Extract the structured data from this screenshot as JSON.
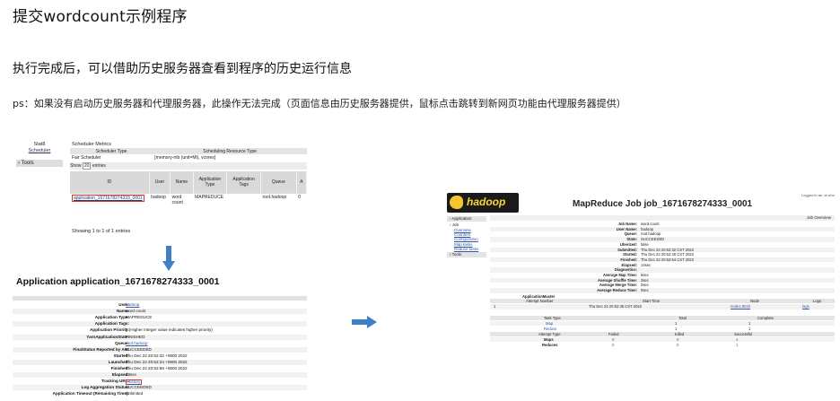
{
  "slide": {
    "title": "提交wordcount示例程序",
    "line1": "执行完成后，可以借助历史服务器查看到程序的历史运行信息",
    "note": "ps：如果没有启动历史服务器和代理服务器，此操作无法完成（页面信息由历史服务器提供，鼠标点击跳转到新网页功能由代理服务器提供）"
  },
  "scheduler_shot": {
    "nav": {
      "item1": "Stat8",
      "item2": "Scheduler",
      "tools": "› Tools"
    },
    "metrics_title": "Scheduler Metrics",
    "col_type": "Scheduler Type",
    "col_resource": "Scheduling Resource Type",
    "type_value": "Fair Scheduler",
    "resource_value": "[memory-mb (unit=Mi), vcores]",
    "show_label": "Show",
    "show_value": "20",
    "entries_label": "entries",
    "headers": [
      "ID",
      "User",
      "Name",
      "Application Type",
      "Application Tags",
      "Queue",
      "A"
    ],
    "row": {
      "id": "application_1671678274333_0001",
      "user": "hadoop",
      "name": "word count",
      "type": "MAPREDUCE",
      "tags": "",
      "queue": "root.hadoop",
      "extra": "0"
    },
    "showing": "Showing 1 to 1 of 1 entries"
  },
  "app_heading": "Application application_1671678274333_0001",
  "app_details": [
    {
      "k": "User:",
      "v": "hadoop",
      "link": true
    },
    {
      "k": "Name:",
      "v": "word count"
    },
    {
      "k": "Application Type:",
      "v": "MAPREDUCE"
    },
    {
      "k": "Application Tags:",
      "v": ""
    },
    {
      "k": "Application Priority:",
      "v": "0 (Higher Integer value indicates higher priority)"
    },
    {
      "k": "YarnApplicationState:",
      "v": "FINISHED"
    },
    {
      "k": "Queue:",
      "v": "root.hadoop",
      "link": true
    },
    {
      "k": "FinalStatus Reported by AM:",
      "v": "SUCCEEDED"
    },
    {
      "k": "Started:",
      "v": "Thu Dec 22 20:52:32 +0800 2022"
    },
    {
      "k": "Launched:",
      "v": "Thu Dec 22 20:52:34 +0800 2022"
    },
    {
      "k": "Finished:",
      "v": "Thu Dec 22 20:52:56 +0800 2022"
    },
    {
      "k": "Elapsed:",
      "v": "24sec"
    },
    {
      "k": "Tracking URL:",
      "v": "History",
      "boxed": true
    },
    {
      "k": "Log Aggregation Status:",
      "v": "SUCCEEDED"
    },
    {
      "k": "Application Timeout (Remaining Time):",
      "v": "Unlimited"
    }
  ],
  "mr_shot": {
    "logo_text": "hadoop",
    "title": "MapReduce Job job_1671678274333_0001",
    "logged_in": "Logged in as: dr.who",
    "side": {
      "application": "› Application",
      "job": "› Job",
      "links": [
        "Overview",
        "Counters",
        "Configuration",
        "Map tasks",
        "Reduce tasks"
      ],
      "tools": "› Tools"
    },
    "job_overview": "Job Overview",
    "details": [
      {
        "k": "Job Name:",
        "v": "word count"
      },
      {
        "k": "User Name:",
        "v": "hadoop"
      },
      {
        "k": "Queue:",
        "v": "root.hadoop"
      },
      {
        "k": "State:",
        "v": "SUCCEEDED"
      },
      {
        "k": "Uberized:",
        "v": "false"
      },
      {
        "k": "Submitted:",
        "v": "Thu Dec 22 20:52:32 CST 2022"
      },
      {
        "k": "Started:",
        "v": "Thu Dec 22 20:52:40 CST 2022"
      },
      {
        "k": "Finished:",
        "v": "Thu Dec 22 20:52:54 CST 2022"
      },
      {
        "k": "Elapsed:",
        "v": "14sec"
      },
      {
        "k": "Diagnostics:",
        "v": ""
      },
      {
        "k": "Average Map Time:",
        "v": "5sec"
      },
      {
        "k": "Average Shuffle Time:",
        "v": "3sec"
      },
      {
        "k": "Average Merge Time:",
        "v": "0sec"
      },
      {
        "k": "Average Reduce Time:",
        "v": "0sec"
      }
    ],
    "am_label": "ApplicationMaster",
    "am_headers": [
      "Attempt Number",
      "Start Time",
      "Node",
      "Logs"
    ],
    "am_row": [
      "1",
      "Thu Dec 22 20:52:35 CST 2022",
      "node1:8042",
      "logs"
    ],
    "task_headers": [
      "Task Type",
      "Total",
      "Complete"
    ],
    "task_rows": [
      {
        "type": "Map",
        "total": "1",
        "complete": "1"
      },
      {
        "type": "Reduce",
        "total": "1",
        "complete": "1"
      }
    ],
    "attempt_headers": [
      "Attempt Type",
      "Failed",
      "Killed",
      "Successful"
    ],
    "attempt_rows": [
      {
        "type": "Maps",
        "failed": "0",
        "killed": "0",
        "successful": "1"
      },
      {
        "type": "Reduces",
        "failed": "0",
        "killed": "0",
        "successful": "1"
      }
    ]
  }
}
